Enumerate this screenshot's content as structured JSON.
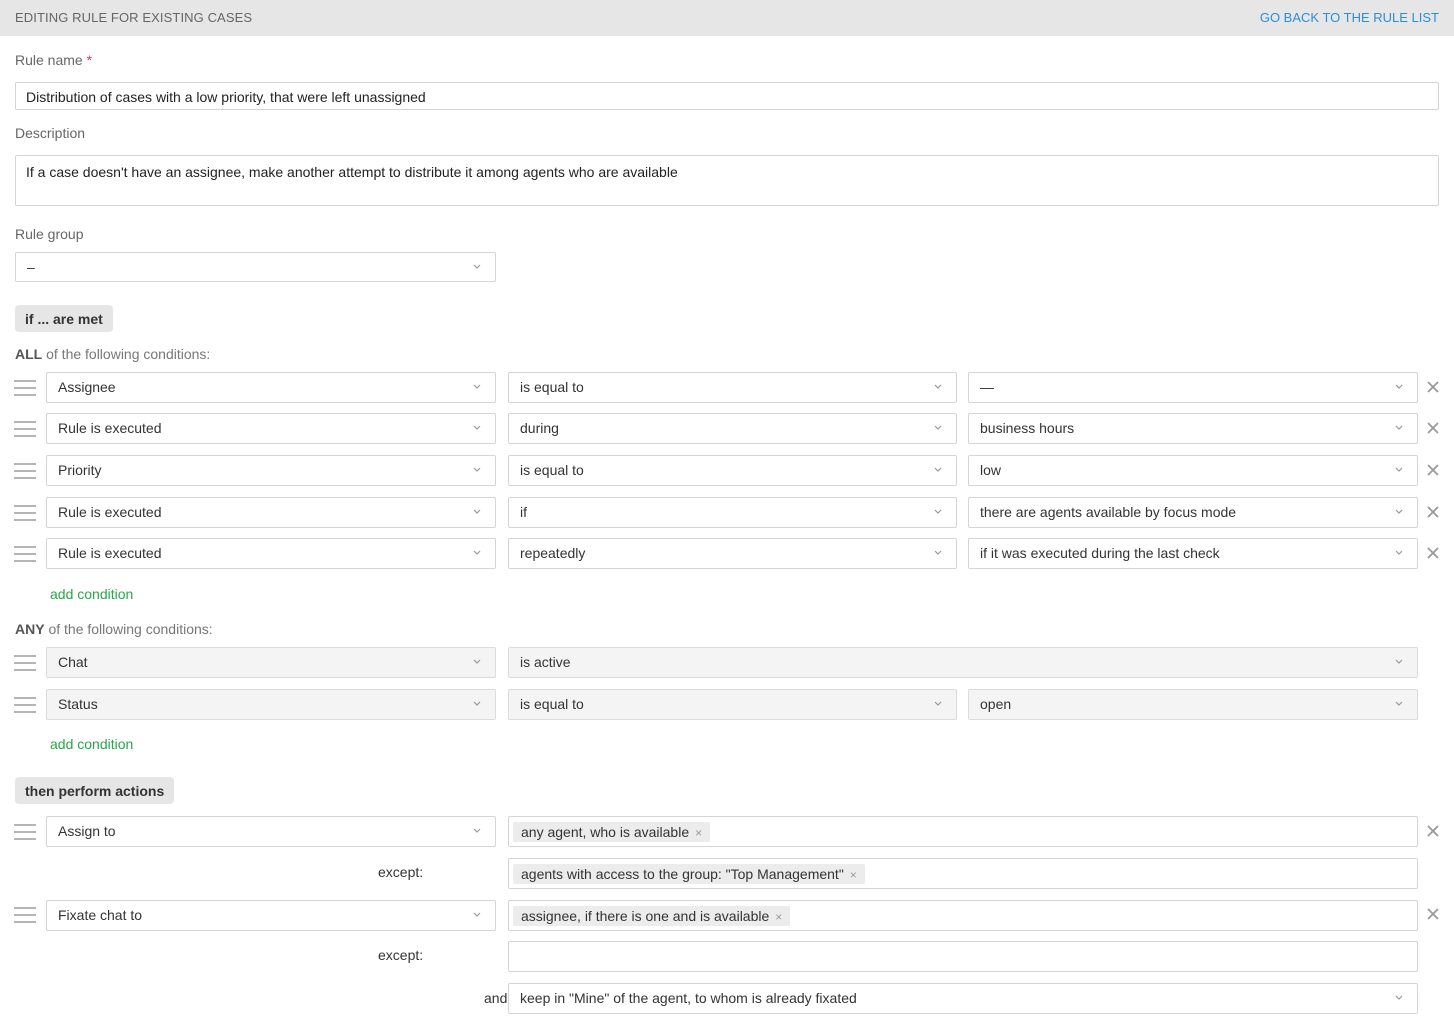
{
  "header": {
    "title": "EDITING RULE FOR EXISTING CASES",
    "back_link": "GO BACK TO THE RULE LIST"
  },
  "form": {
    "rule_name_label": "Rule name",
    "required_mark": "*",
    "rule_name_value": "Distribution of cases with a low priority, that were left unassigned",
    "description_label": "Description",
    "description_value": "If a case doesn't have an assignee, make another attempt to distribute it among agents who are available",
    "rule_group_label": "Rule group",
    "rule_group_value": "–"
  },
  "if_section": {
    "pill": "if ... are met",
    "all_prefix": "ALL",
    "all_suffix": " of the following conditions:",
    "all_conditions": [
      {
        "field": "Assignee",
        "operator": "is equal to",
        "value": "—"
      },
      {
        "field": "Rule is executed",
        "operator": "during",
        "value": "business hours"
      },
      {
        "field": "Priority",
        "operator": "is equal to",
        "value": "low"
      },
      {
        "field": "Rule is executed",
        "operator": "if",
        "value": "there are agents available by focus mode"
      },
      {
        "field": "Rule is executed",
        "operator": "repeatedly",
        "value": "if it was executed during the last check"
      }
    ],
    "add_condition_all": "add condition",
    "any_prefix": "ANY",
    "any_suffix": " of the following conditions:",
    "any_conditions": [
      {
        "field": "Chat",
        "operator": "is active"
      },
      {
        "field": "Status",
        "operator": "is equal to",
        "value": "open"
      }
    ],
    "add_condition_any": "add condition"
  },
  "then_section": {
    "pill": "then perform actions",
    "actions": [
      {
        "action": "Assign to",
        "tag": "any agent, who is available",
        "except_label": "except:",
        "except_tag": "agents with access to the group: \"Top Management\""
      },
      {
        "action": "Fixate chat to",
        "tag": "assignee, if there is one and is available",
        "except_label": "except:",
        "and_label": "and",
        "and_value": "keep in \"Mine\" of the agent, to whom is already fixated"
      }
    ],
    "tag_remove_icon": "×"
  },
  "icons": {
    "chevron": "chevron-down-icon",
    "remove": "close-icon",
    "drag": "drag-handle-icon"
  },
  "colors": {
    "link_blue": "#2a8fd6",
    "link_green": "#27a64a",
    "required": "#e03b3b"
  }
}
